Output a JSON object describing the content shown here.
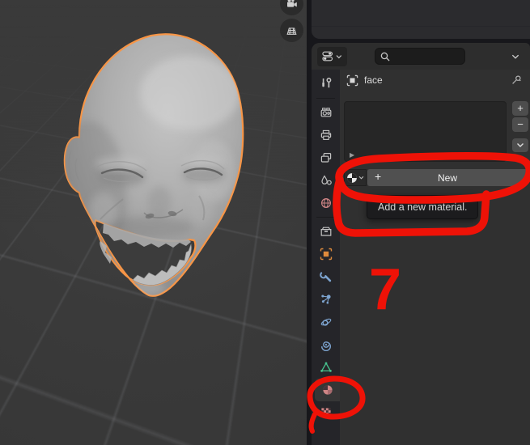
{
  "colors": {
    "annotation_red": "#ee1207",
    "selection_orange": "#f79546",
    "tab_blue": "#7da4d0",
    "tab_green": "#46c28e",
    "tab_pink": "#cf8585",
    "tab_orange": "#e08b3c"
  },
  "viewport": {
    "nav_buttons": [
      {
        "name": "camera-view-button",
        "icon": "camera-icon"
      },
      {
        "name": "orthographic-grid-button",
        "icon": "grid-icon"
      }
    ],
    "scene_object": "sculpted head (selected, orange outline)"
  },
  "properties": {
    "header": {
      "editor_type_icon": "properties-editor-icon",
      "search": {
        "value": "",
        "placeholder": ""
      },
      "options_icon": "chevron-down-icon"
    },
    "breadcrumb": {
      "object_icon": "object-icon",
      "object_name": "face",
      "pin_icon": "pin-icon"
    },
    "tabs": [
      {
        "id": "tool",
        "icon": "tool-icon",
        "active": false
      },
      {
        "id": "render",
        "icon": "render-camera-icon",
        "active": false
      },
      {
        "id": "output",
        "icon": "output-printer-icon",
        "active": false
      },
      {
        "id": "view-layer",
        "icon": "view-layer-icon",
        "active": false
      },
      {
        "id": "scene",
        "icon": "scene-icon",
        "active": false
      },
      {
        "id": "world",
        "icon": "world-globe-icon",
        "active": false
      },
      {
        "id": "collection",
        "icon": "collection-box-icon",
        "active": false
      },
      {
        "id": "object",
        "icon": "object-square-icon",
        "active": false
      },
      {
        "id": "modifiers",
        "icon": "wrench-icon",
        "active": false
      },
      {
        "id": "particles",
        "icon": "particles-icon",
        "active": false
      },
      {
        "id": "physics",
        "icon": "physics-orbit-icon",
        "active": false
      },
      {
        "id": "constraints",
        "icon": "constraint-spiral-icon",
        "active": false
      },
      {
        "id": "object-data",
        "icon": "mesh-triangle-icon",
        "active": false
      },
      {
        "id": "material",
        "icon": "material-sphere-icon",
        "active": true
      },
      {
        "id": "texture",
        "icon": "texture-checker-icon",
        "active": false
      }
    ],
    "material_slots": {
      "expand_glyph": "▶",
      "add_button": "+",
      "remove_button": "−",
      "specials_icon": "chevron-down-icon"
    },
    "material_selector": {
      "browse_icon": "material-sphere-icon",
      "new_button_plus": "+",
      "new_button_label": "New"
    },
    "tooltip": {
      "text": "Add a new material."
    }
  },
  "annotations": {
    "step_number": "7",
    "circled_elements": [
      "new-material-button-row",
      "tooltip",
      "material-properties-tab"
    ]
  }
}
